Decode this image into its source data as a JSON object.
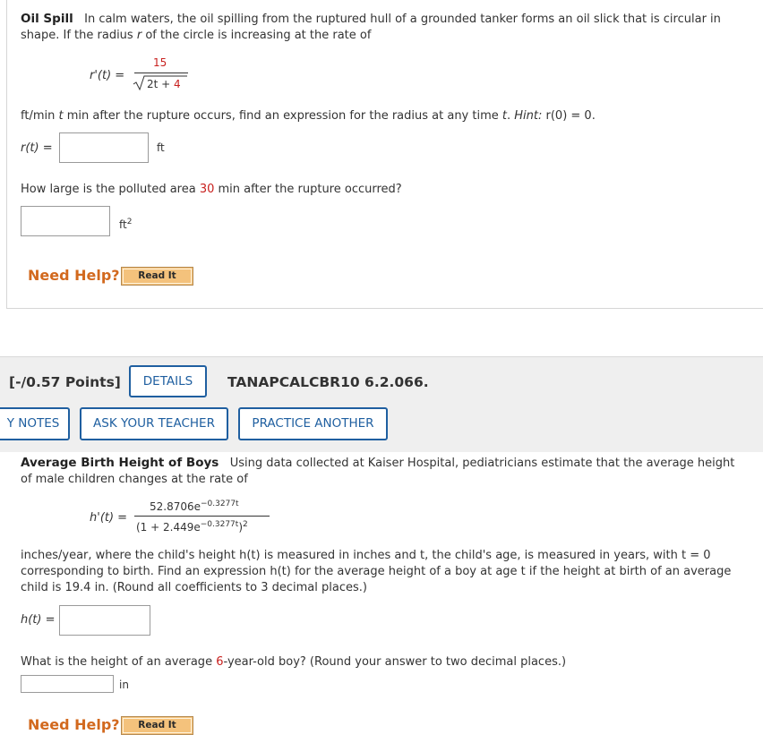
{
  "q1": {
    "title": "Oil Spill",
    "intro_line1": "In calm waters, the oil spilling from the ruptured hull of a grounded tanker forms an oil slick that is circular in",
    "intro_line2_a": "shape. If the radius ",
    "intro_line2_var": "r",
    "intro_line2_b": " of the circle is increasing at the rate of",
    "formula_lhs": "r'(t) =",
    "formula_numerator": "15",
    "formula_denominator_a": "2t + ",
    "formula_denominator_b": "4",
    "rate_text_a": "ft/min ",
    "rate_text_t": "t",
    "rate_text_b": " min after the rupture occurs, find an expression for the radius at any time ",
    "rate_text_t2": "t",
    "rate_text_c": ". ",
    "hint_label": "Hint:",
    "hint_value": " r(0) = 0.",
    "answer1_label": "r(t) =",
    "answer1_unit": "ft",
    "q2_text_a": "How large is the polluted area ",
    "q2_minutes": "30",
    "q2_text_b": " min after the rupture occurred?",
    "answer2_unit": "ft",
    "answer2_unit_sup": "2",
    "need_help": "Need Help?",
    "read_it": "Read It"
  },
  "q2_header": {
    "points": "[-/0.57 Points]",
    "details": "DETAILS",
    "reference": "TANAPCALCBR10 6.2.066.",
    "my_notes": "Y NOTES",
    "ask_teacher": "ASK YOUR TEACHER",
    "practice_another": "PRACTICE ANOTHER"
  },
  "q2": {
    "title": "Average Birth Height of Boys",
    "intro_line1": "Using data collected at Kaiser Hospital, pediatricians estimate that the average height",
    "intro_line2": "of male children changes at the rate of",
    "formula_lhs": "h'(t) =",
    "formula_numerator": "52.8706e",
    "formula_numerator_exp": "−0.3277t",
    "formula_denominator": "(1 + 2.449e",
    "formula_denominator_exp": "−0.3277t",
    "formula_denominator_close": ")",
    "formula_denominator_pow": "2",
    "body_line1": "inches/year, where the child's height h(t) is measured in inches and t, the child's age, is measured in years, with t = 0",
    "body_line2": "corresponding to birth. Find an expression h(t) for the average height of a boy at age t if the height at birth of an average",
    "body_line3": "child is 19.4 in. (Round all coefficients to 3 decimal places.)",
    "answer1_label": "h(t) =",
    "q2_text_a": "What is the height of an average ",
    "q2_age": "6",
    "q2_text_b": "-year-old boy? (Round your answer to two decimal places.)",
    "answer2_unit": "in",
    "need_help": "Need Help?",
    "read_it": "Read It"
  },
  "colors": {
    "accent_blue": "#1f5fa0",
    "need_help_orange": "#d2691e",
    "highlight_red": "#c8201e",
    "read_it_button": "#f4c27c"
  }
}
